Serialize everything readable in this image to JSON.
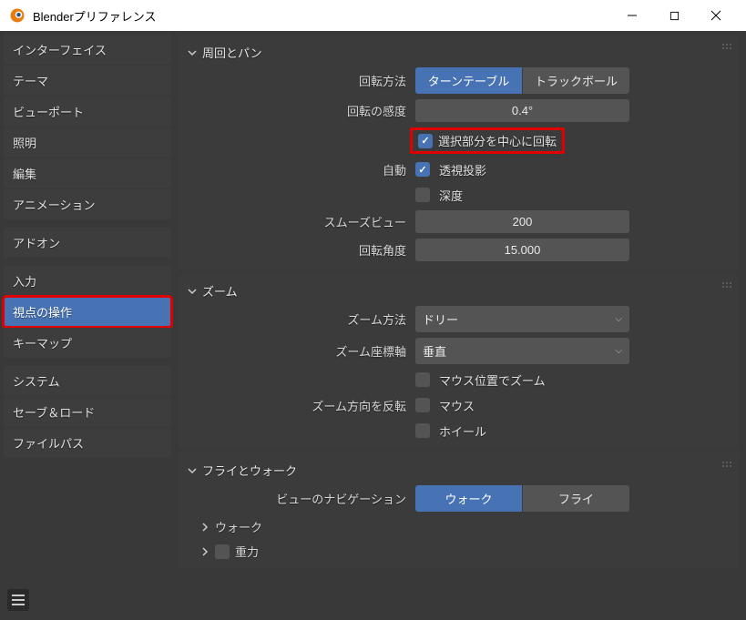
{
  "window": {
    "title": "Blenderプリファレンス"
  },
  "sidebar": {
    "groups": [
      [
        "インターフェイス",
        "テーマ",
        "ビューポート",
        "照明",
        "編集",
        "アニメーション"
      ],
      [
        "アドオン"
      ],
      [
        "入力",
        "視点の操作",
        "キーマップ"
      ],
      [
        "システム",
        "セーブ＆ロード",
        "ファイルパス"
      ]
    ],
    "active": "視点の操作"
  },
  "panels": {
    "orbit": {
      "title": "周回とパン",
      "rotation_method_label": "回転方法",
      "rotation_method_options": [
        "ターンテーブル",
        "トラックボール"
      ],
      "rotation_method_active": 0,
      "rotation_sensitivity_label": "回転の感度",
      "rotation_sensitivity_value": "0.4°",
      "orbit_around_selection_label": "選択部分を中心に回転",
      "orbit_around_selection_checked": true,
      "auto_label": "自動",
      "perspective_label": "透視投影",
      "perspective_checked": true,
      "depth_label": "深度",
      "depth_checked": false,
      "smooth_view_label": "スムーズビュー",
      "smooth_view_value": "200",
      "rotation_angle_label": "回転角度",
      "rotation_angle_value": "15.000"
    },
    "zoom": {
      "title": "ズーム",
      "zoom_method_label": "ズーム方法",
      "zoom_method_value": "ドリー",
      "zoom_axis_label": "ズーム座標軸",
      "zoom_axis_value": "垂直",
      "zoom_to_mouse_label": "マウス位置でズーム",
      "zoom_to_mouse_checked": false,
      "invert_zoom_label": "ズーム方向を反転",
      "invert_mouse_label": "マウス",
      "invert_mouse_checked": false,
      "invert_wheel_label": "ホイール",
      "invert_wheel_checked": false
    },
    "fly": {
      "title": "フライとウォーク",
      "nav_label": "ビューのナビゲーション",
      "nav_options": [
        "ウォーク",
        "フライ"
      ],
      "nav_active": 0,
      "walk_sub": "ウォーク",
      "gravity_sub": "重力"
    }
  }
}
